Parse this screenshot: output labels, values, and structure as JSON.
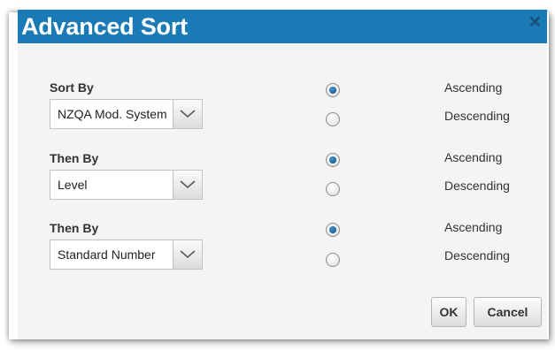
{
  "dialog": {
    "title": "Advanced Sort",
    "close_glyph": "✕"
  },
  "sort_rows": [
    {
      "label": "Sort By",
      "value": "NZQA Mod. System",
      "order": "Ascending"
    },
    {
      "label": "Then By",
      "value": "Level",
      "order": "Ascending"
    },
    {
      "label": "Then By",
      "value": "Standard Number",
      "order": "Ascending"
    }
  ],
  "options": {
    "ascending": "Ascending",
    "descending": "Descending"
  },
  "buttons": {
    "ok": "OK",
    "cancel": "Cancel"
  },
  "colors": {
    "title_bar": "#1a7ab5",
    "content_bg": "#f4f4f4",
    "radio_selected": "#1a6aa8"
  },
  "icons": [
    "close-icon",
    "chevron-down-icon"
  ]
}
